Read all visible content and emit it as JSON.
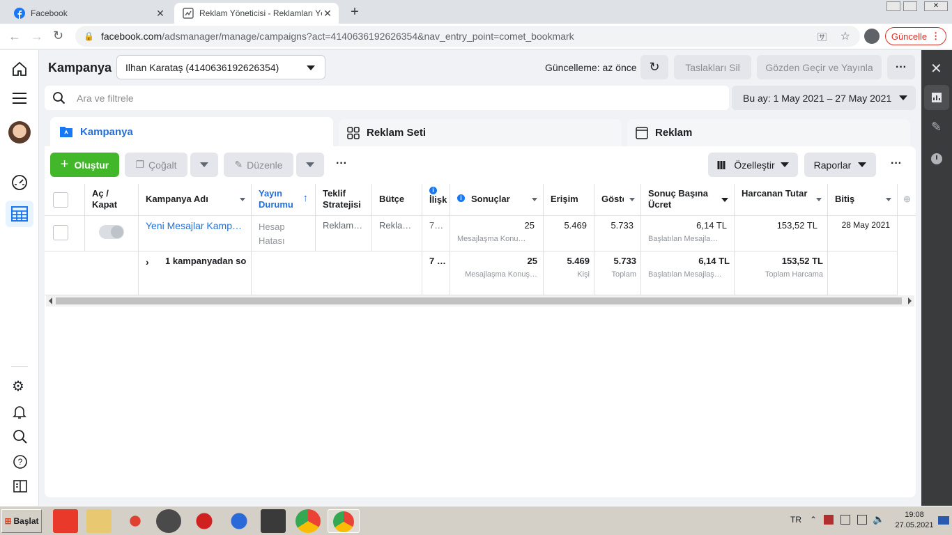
{
  "browser": {
    "tabs": [
      {
        "title": "Facebook"
      },
      {
        "title": "Reklam Yöneticisi - Reklamları Yöne"
      }
    ],
    "url": {
      "host": "facebook.com",
      "path": "/adsmanager/manage/campaigns?act=4140636192626354&nav_entry_point=comet_bookmark"
    },
    "update_label": "Güncelle"
  },
  "header": {
    "title": "Kampanya",
    "account": "Ilhan Karataş (4140636192626354)",
    "updated": "Güncelleme: az önce",
    "discard_label": "Taslakları Sil",
    "publish_label": "Gözden Geçir ve Yayınla"
  },
  "search": {
    "placeholder": "Ara ve filtrele"
  },
  "date_range": "Bu ay: 1 May 2021 – 27 May 2021",
  "level_tabs": [
    {
      "label": "Kampanya"
    },
    {
      "label": "Reklam Seti"
    },
    {
      "label": "Reklam"
    }
  ],
  "toolbar": {
    "create": "Oluştur",
    "duplicate": "Çoğalt",
    "edit": "Düzenle",
    "customize": "Özelleştir",
    "reports": "Raporlar"
  },
  "table": {
    "columns": [
      "Aç / Kapat",
      "Kampanya Adı",
      "Yayın Durumu",
      "Teklif Stratejisi",
      "Bütçe",
      "İlişk Aya",
      "Sonuçlar",
      "Erişim",
      "Gösterim",
      "Sonuç Başına Ücret",
      "Harcanan Tutar",
      "Bitiş"
    ],
    "row": {
      "name": "Yeni Mesajlar Kamp…",
      "status": "Hesap Hatası",
      "bid": "Reklam…",
      "budget": "Rekla…",
      "attr": "7…",
      "results": "25",
      "results_sub": "Mesajlaşma Konu…",
      "reach": "5.469",
      "impressions": "5.733",
      "cpr": "6,14 TL",
      "cpr_sub": "Başlatılan Mesajla…",
      "spent": "153,52 TL",
      "end": "28 May 2021"
    },
    "summary": {
      "label": "1 kampanyadan so",
      "attr": "7 …",
      "results": "25",
      "results_sub": "Mesajlaşma Konuş…",
      "reach": "5.469",
      "reach_sub": "Kişi",
      "impressions": "5.733",
      "impressions_sub": "Toplam",
      "cpr": "6,14 TL",
      "cpr_sub": "Başlatılan Mesajlaş…",
      "spent": "153,52 TL",
      "spent_sub": "Toplam Harcama"
    }
  },
  "taskbar": {
    "start": "Başlat",
    "lang": "TR",
    "time": "19:08",
    "date": "27.05.2021"
  },
  "colors": {
    "fb_blue": "#1877f2",
    "green": "#42b72a",
    "link": "#216fdb"
  }
}
